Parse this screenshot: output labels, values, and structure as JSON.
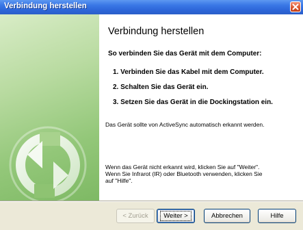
{
  "window": {
    "title": "Verbindung herstellen"
  },
  "content": {
    "heading": "Verbindung herstellen",
    "intro": "So verbinden Sie das Gerät mit dem Computer:",
    "steps": [
      "1. Verbinden Sie das Kabel mit dem Computer.",
      "2. Schalten Sie das Gerät ein.",
      "3. Setzen Sie das Gerät in die Dockingstation ein."
    ],
    "note": "Das Gerät sollte von ActiveSync automatisch erkannt werden.",
    "hint_lines": [
      "Wenn das Gerät nicht erkannt wird, klicken Sie auf \"Weiter\".",
      "Wenn Sie Infrarot (IR) oder Bluetooth verwenden, klicken Sie",
      "auf \"Hilfe\"."
    ]
  },
  "buttons": {
    "back": "< Zurück",
    "next": "Weiter >",
    "cancel": "Abbrechen",
    "help": "Hilfe"
  },
  "icons": {
    "close": "close-icon",
    "sync": "sync-arrows-icon"
  },
  "colors": {
    "titlebar": "#2d66d9",
    "side_panel": "#93c779",
    "dialog_bg": "#ece9d8"
  }
}
